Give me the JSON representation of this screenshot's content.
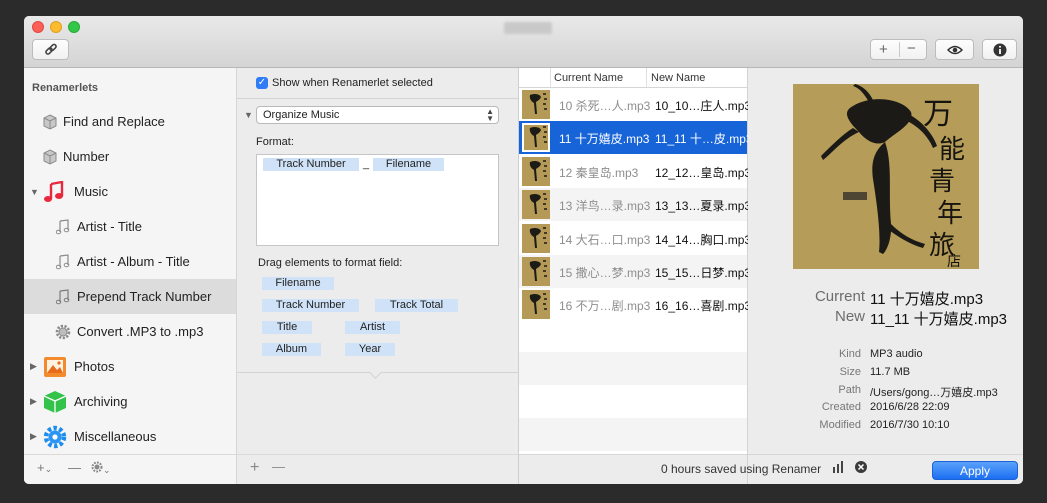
{
  "toolbar": {
    "link_icon": "link-icon",
    "add_icon": "plus-icon",
    "remove_icon": "minus-icon",
    "preview_icon": "eye-icon",
    "info_icon": "info-icon"
  },
  "sidebar": {
    "header": "Renamerlets",
    "items": [
      {
        "label": "Find and Replace",
        "icon": "cube-icon"
      },
      {
        "label": "Number",
        "icon": "cube-icon"
      },
      {
        "label": "Music",
        "icon": "music-note-icon"
      },
      {
        "label": "Artist - Title",
        "icon": "music-note-icon"
      },
      {
        "label": "Artist - Album - Title",
        "icon": "music-note-icon"
      },
      {
        "label": "Prepend Track Number",
        "icon": "music-note-icon"
      },
      {
        "label": "Convert .MP3 to .mp3",
        "icon": "gear-icon"
      },
      {
        "label": "Photos",
        "icon": "photos-icon"
      },
      {
        "label": "Archiving",
        "icon": "archive-box-icon"
      },
      {
        "label": "Miscellaneous",
        "icon": "gear-icon"
      }
    ],
    "footer": {
      "add": "+",
      "add_caret": "⌄",
      "remove": "—",
      "gear_caret": "⌄"
    }
  },
  "editor": {
    "show_when_selected": "Show when Renamerlet selected",
    "show_checked": true,
    "action_select": "Organize Music",
    "format_label": "Format:",
    "format_tokens": [
      "Track Number",
      "_",
      "Filename"
    ],
    "drag_label": "Drag elements to format field:",
    "palette": [
      "Filename",
      "Track Number",
      "Track Total",
      "Title",
      "Artist",
      "Album",
      "Year"
    ],
    "footer": {
      "add": "+",
      "remove": "—"
    }
  },
  "list": {
    "headers": [
      "Current Name",
      "New Name"
    ],
    "rows": [
      {
        "current": "10 杀死…人.mp3",
        "new": "10_10…庄人.mp3"
      },
      {
        "current": "11 十万嬉皮.mp3",
        "new": "11_11 十…皮.mp3"
      },
      {
        "current": "12 秦皇岛.mp3",
        "new": "12_12…皇岛.mp3"
      },
      {
        "current": "13 洋鸟…录.mp3",
        "new": "13_13…夏录.mp3"
      },
      {
        "current": "14 大石…口.mp3",
        "new": "14_14…胸口.mp3"
      },
      {
        "current": "15 撒心…梦.mp3",
        "new": "15_15…日梦.mp3"
      },
      {
        "current": "16 不万…剧.mp3",
        "new": "16_16…喜剧.mp3"
      }
    ],
    "selected_index": 1,
    "footer_text": "0 hours saved using Renamer",
    "stats_icon": "bar-chart-icon",
    "clear_icon": "close-circle-icon"
  },
  "detail": {
    "current_label": "Current",
    "current_value": "11 十万嬉皮.mp3",
    "new_label": "New",
    "new_value": "11_11 十万嬉皮.mp3",
    "meta": [
      {
        "label": "Kind",
        "value": "MP3 audio"
      },
      {
        "label": "Size",
        "value": "11.7 MB"
      },
      {
        "label": "Path",
        "value": "/Users/gong…万嬉皮.mp3"
      },
      {
        "label": "Created",
        "value": "2016/6/28 22:09"
      },
      {
        "label": "Modified",
        "value": "2016/7/30 10:10"
      }
    ],
    "cover_text": "万能青年旅店",
    "apply": "Apply"
  }
}
